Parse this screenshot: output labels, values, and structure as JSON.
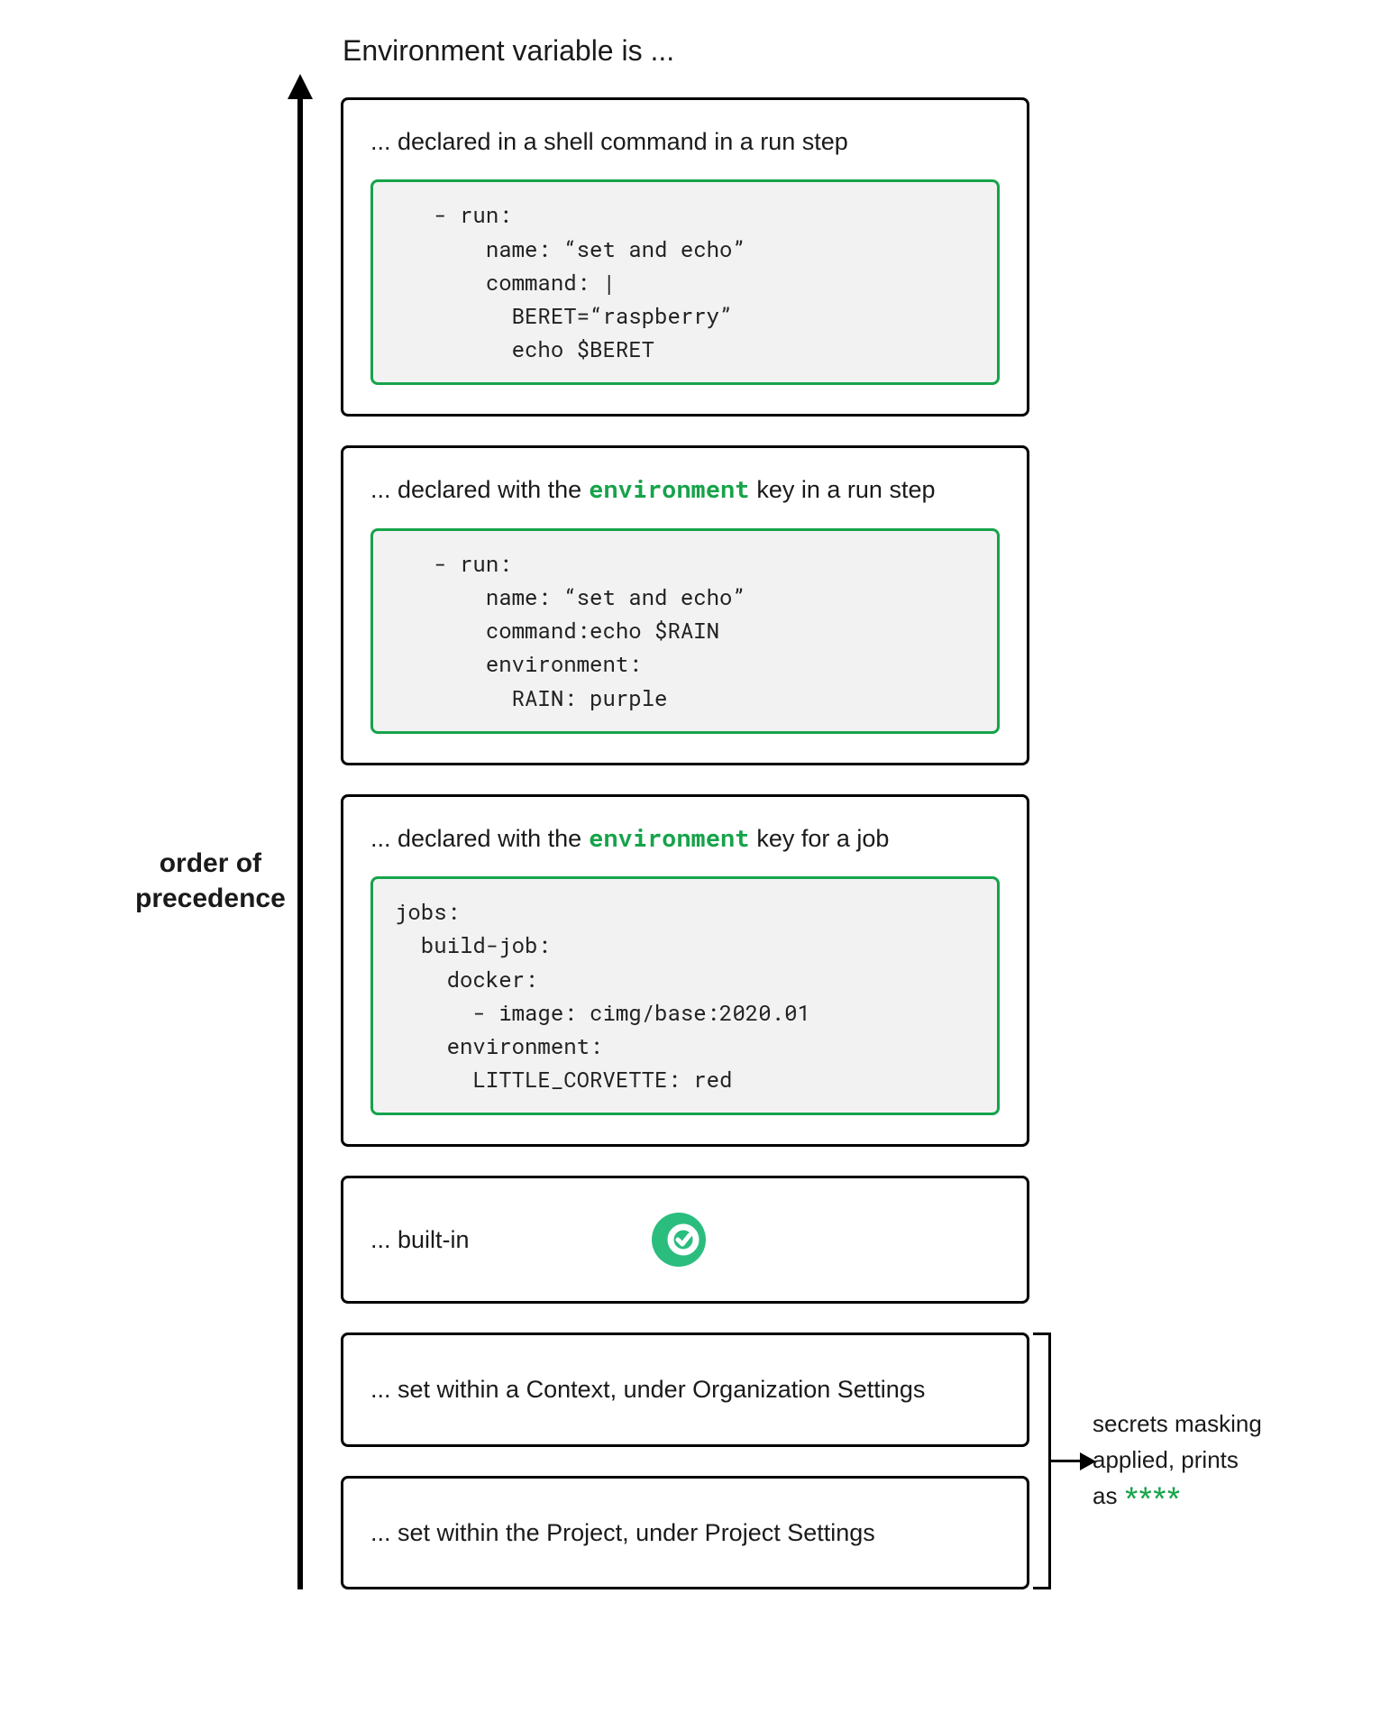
{
  "title": "Environment variable is ...",
  "precedence_label_line1": "order of",
  "precedence_label_line2": "precedence",
  "boxes": {
    "b1": {
      "desc": "... declared in a shell command in a run step",
      "code": "   - run:\n       name: “set and echo”\n       command: |\n         BERET=“raspberry”\n         echo $BERET"
    },
    "b2": {
      "desc_pre": "... declared with the",
      "desc_kw": "environment",
      "desc_post": "key in a run step",
      "code": "   - run:\n       name: “set and echo”\n       command:echo $RAIN\n       environment:\n         RAIN: purple"
    },
    "b3": {
      "desc_pre": "... declared with the",
      "desc_kw": "environment",
      "desc_post": "key for a job",
      "code": "jobs:\n  build-job:\n    docker:\n      - image: cimg/base:2020.01\n    environment:\n      LITTLE_CORVETTE: red"
    },
    "b4": {
      "desc": "... built-in"
    },
    "b5": {
      "desc": "... set within a Context, under Organization Settings"
    },
    "b6": {
      "desc": "... set within the Project, under Project Settings"
    }
  },
  "mask_label_line1": "secrets masking",
  "mask_label_line2": "applied, prints",
  "mask_label_line3_pre": "as ",
  "mask_label_stars": "****",
  "icons": {
    "check_circle": "check-circle-icon"
  }
}
